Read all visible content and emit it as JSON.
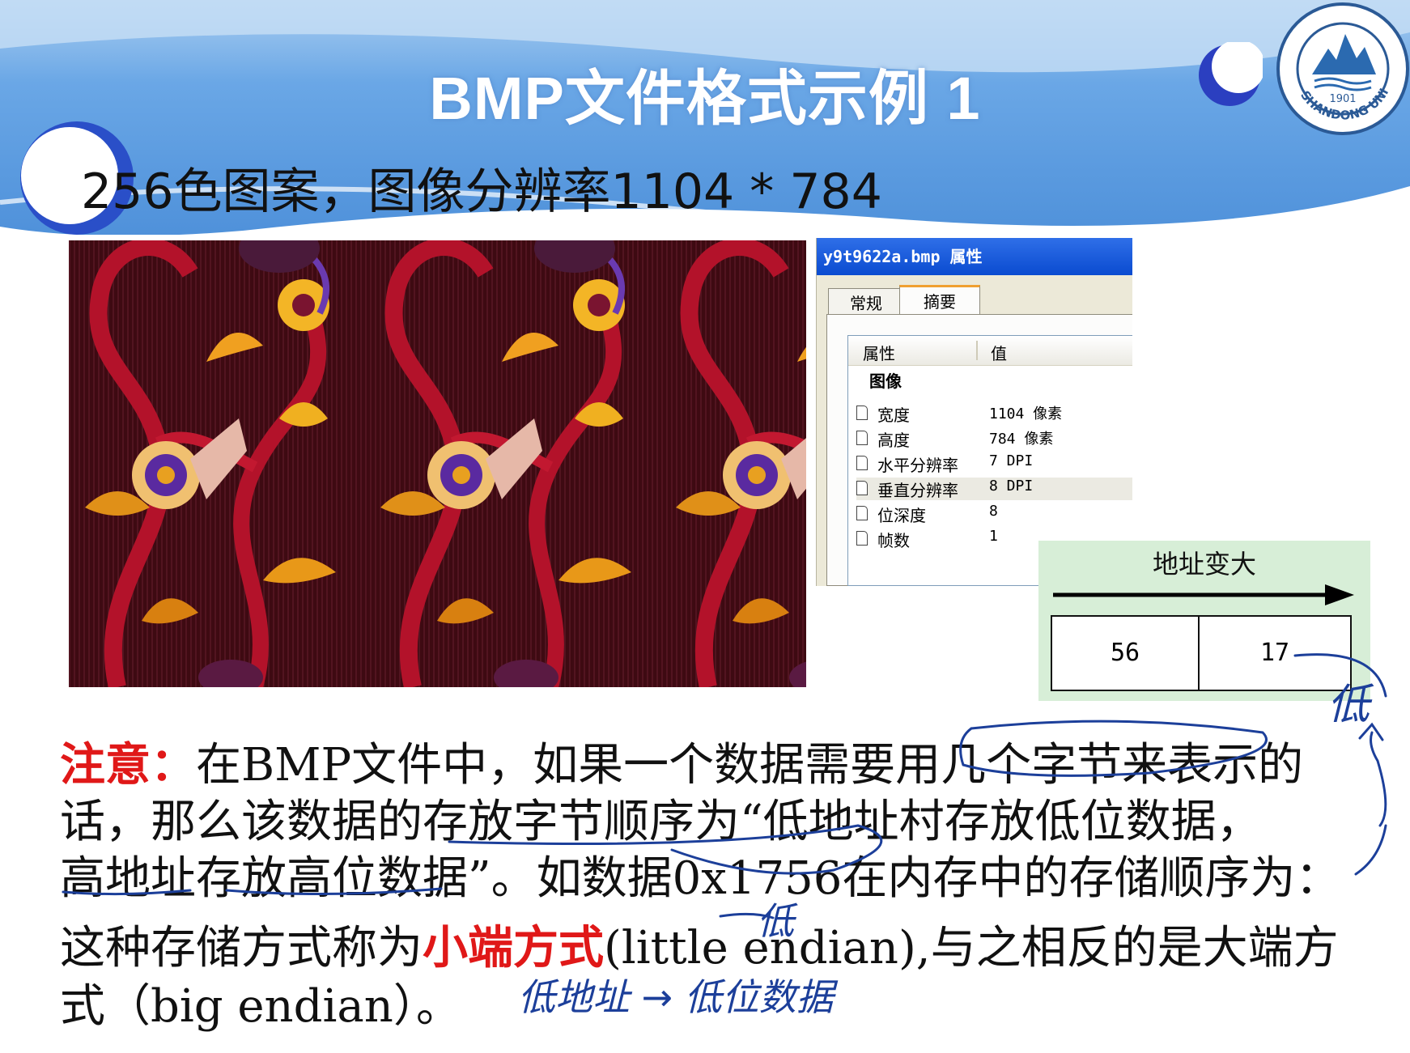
{
  "slide": {
    "title": "BMP文件格式示例 1",
    "subtitle": "256色图案，图像分辨率1104 * 784",
    "seal_text": "SHANDONG UNIVERSITY 1901",
    "colors": {
      "header_blue": "#5a9be0",
      "title_white": "#ffffff",
      "highlight_red": "#e01818",
      "ink_blue": "#1c3f9a",
      "byte_box_green": "#d7eed7"
    }
  },
  "properties_dialog": {
    "title": "y9t9622a.bmp 属性",
    "tabs": [
      "常规",
      "摘要"
    ],
    "active_tab": "摘要",
    "columns": [
      "属性",
      "值"
    ],
    "group": "图像",
    "rows": [
      {
        "label": "宽度",
        "value": "1104 像素"
      },
      {
        "label": "高度",
        "value": "784 像素"
      },
      {
        "label": "水平分辨率",
        "value": "7 DPI"
      },
      {
        "label": "垂直分辨率",
        "value": "8 DPI"
      },
      {
        "label": "位深度",
        "value": "8"
      },
      {
        "label": "帧数",
        "value": "1"
      }
    ]
  },
  "byte_order": {
    "label": "地址变大",
    "low_byte": "56",
    "high_byte": "17"
  },
  "note": {
    "lead": "注意：",
    "line1": "在BMP文件中，如果一个数据需要用几个字节来表示的",
    "line2": "话，那么该数据的存放字节顺序为“低地址村存放低位数据，",
    "line3": "高地址存放高位数据”。如数据0x1756在内存中的存储顺序为：",
    "line4a": "这种存储方式称为",
    "line4_highlight": "小端方式",
    "line4b": "(little  endian),与之相反的是大端方",
    "line5": "式（big  endian）。"
  },
  "handwriting": {
    "margin_note": "低",
    "above_endian": "低",
    "bottom_note": "低地址 → 低位数据"
  }
}
